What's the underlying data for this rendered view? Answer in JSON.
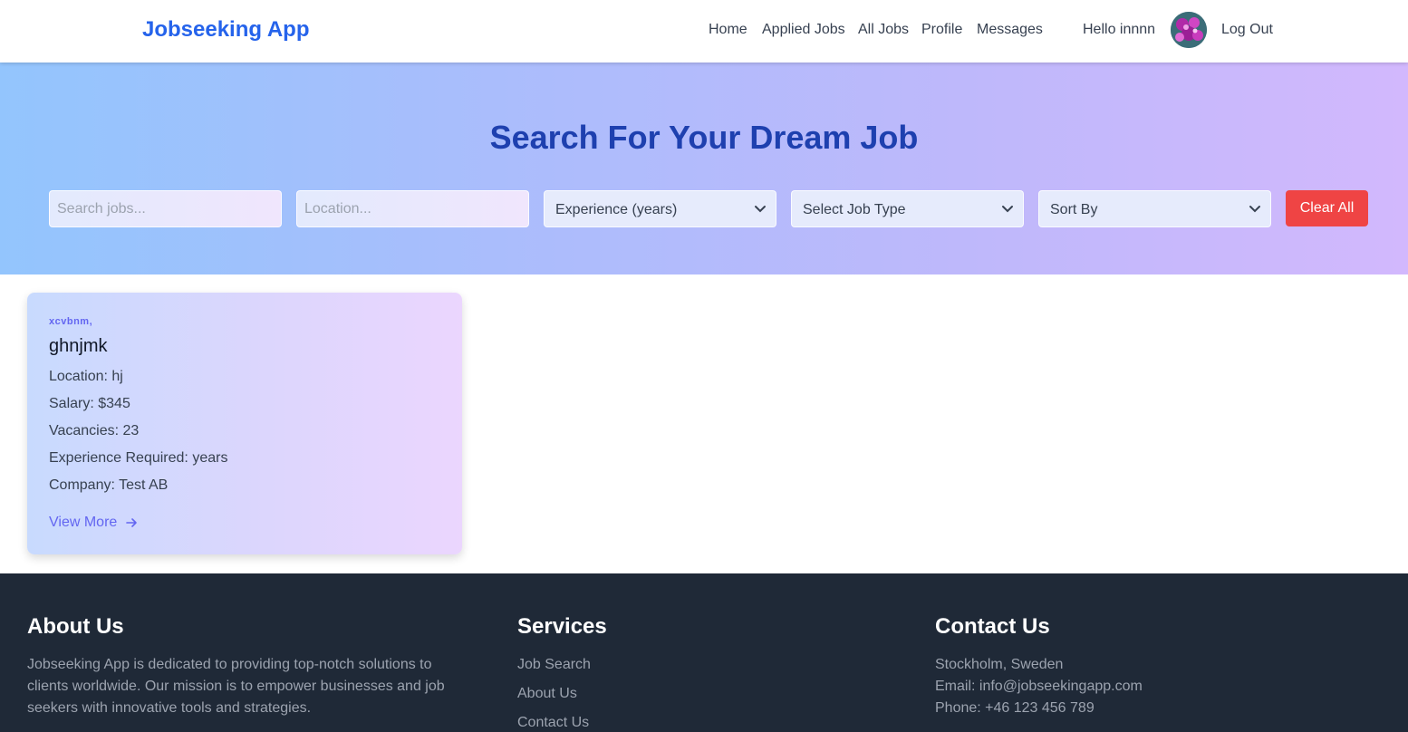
{
  "header": {
    "brand": "Jobseeking App",
    "nav": [
      "Home",
      "Applied Jobs",
      "All Jobs",
      "Profile",
      "Messages"
    ],
    "greeting": "Hello innnn",
    "logout": "Log Out"
  },
  "hero": {
    "title": "Search For Your Dream Job",
    "search_placeholder": "Search jobs...",
    "location_placeholder": "Location...",
    "experience_select": "Experience (years)",
    "job_type_select": "Select Job Type",
    "sort_select": "Sort By",
    "clear_button": "Clear All"
  },
  "jobs": [
    {
      "category": "xcvbnm,",
      "title": "ghnjmk",
      "location": "Location: hj",
      "salary": "Salary: $345",
      "vacancies": "Vacancies: 23",
      "experience": "Experience Required: years",
      "company": "Company: Test AB",
      "view_more": "View More"
    }
  ],
  "footer": {
    "about_title": "About Us",
    "about_text": "Jobseeking App is dedicated to providing top-notch solutions to clients worldwide. Our mission is to empower businesses and job seekers with innovative tools and strategies.",
    "services_title": "Services",
    "services": [
      "Job Search",
      "About Us",
      "Contact Us"
    ],
    "contact_title": "Contact Us",
    "contact": [
      "Stockholm, Sweden",
      "Email: info@jobseekingapp.com",
      "Phone: +46 123 456 789"
    ]
  },
  "colors": {
    "brand": "#2563eb",
    "hero_title": "#1e40af",
    "clear_button": "#ef4444",
    "accent": "#6366f1",
    "footer_bg": "#1f2937"
  },
  "icons": [
    "avatar",
    "chevron-down-icon",
    "arrow-right-icon"
  ]
}
